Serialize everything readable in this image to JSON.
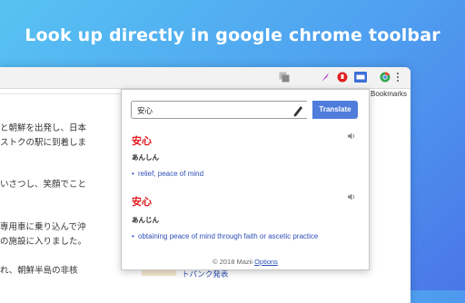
{
  "headline": "Look up directly in google chrome toolbar",
  "browser": {
    "bookmarks_text": "r Bookmarks",
    "page_text_lines": [
      "と朝鮮を出発し、日本",
      "ストクの駅に到着しま",
      "いさつし、笑顔でこと",
      "専用車に乗り込んで沖",
      "の施設に入りました。",
      "れ、朝鮮半島の非核"
    ],
    "below_popup_link": "トパンク発表"
  },
  "popup": {
    "search_value": "安心",
    "translate_label": "Translate",
    "entries": [
      {
        "word": "安心",
        "reading": "あんしん",
        "meaning": "relief, peace of mind"
      },
      {
        "word": "安心",
        "reading": "あんじん",
        "meaning": "obtaining peace of mind through faith or ascetic practice"
      }
    ],
    "footer_text": "© 2018 Mazii",
    "footer_link": "Options"
  },
  "colors": {
    "accent": "#4f7ddc",
    "word_red": "#e0181b",
    "meaning_blue": "#2f4fb8"
  }
}
